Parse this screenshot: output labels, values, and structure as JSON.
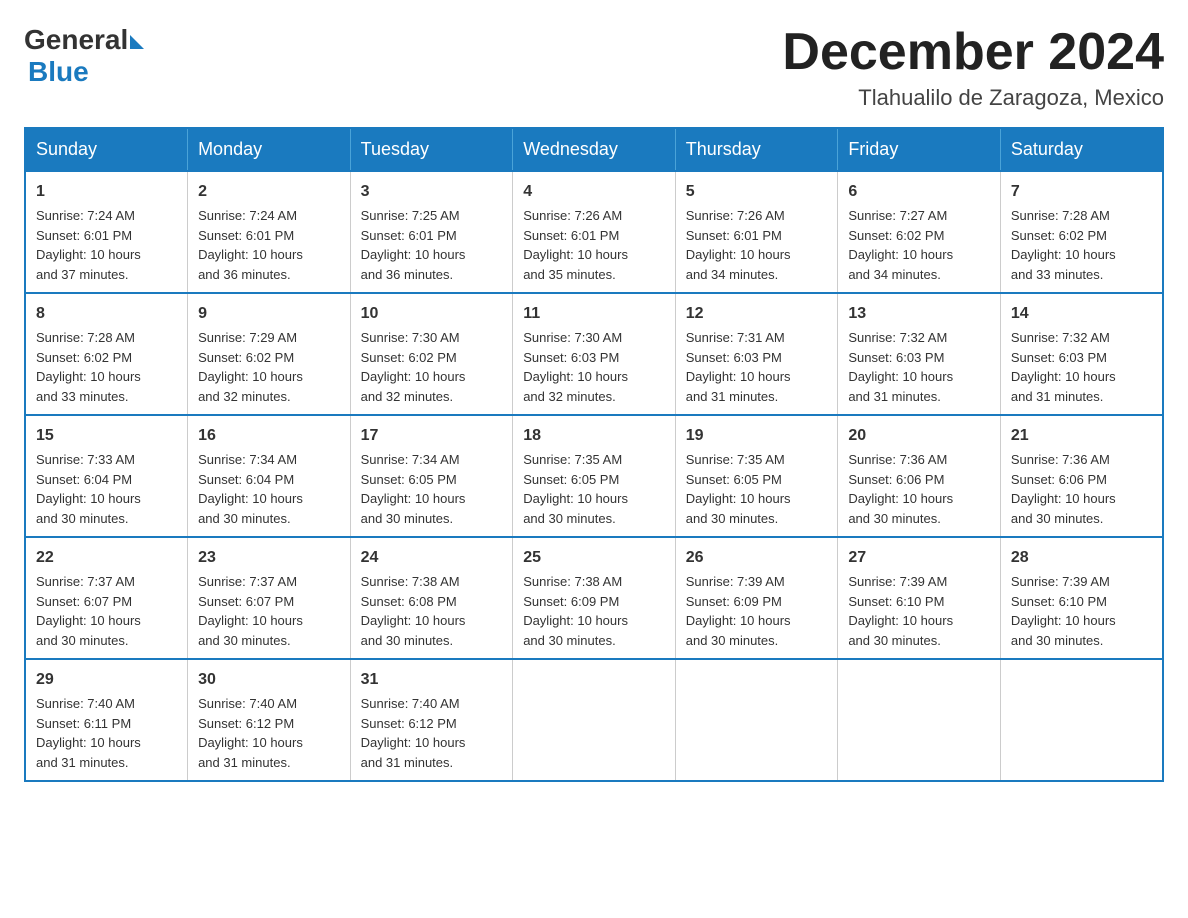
{
  "logo": {
    "general": "General",
    "blue": "Blue"
  },
  "title": "December 2024",
  "subtitle": "Tlahualilo de Zaragoza, Mexico",
  "days_of_week": [
    "Sunday",
    "Monday",
    "Tuesday",
    "Wednesday",
    "Thursday",
    "Friday",
    "Saturday"
  ],
  "weeks": [
    [
      {
        "day": "1",
        "info": "Sunrise: 7:24 AM\nSunset: 6:01 PM\nDaylight: 10 hours\nand 37 minutes."
      },
      {
        "day": "2",
        "info": "Sunrise: 7:24 AM\nSunset: 6:01 PM\nDaylight: 10 hours\nand 36 minutes."
      },
      {
        "day": "3",
        "info": "Sunrise: 7:25 AM\nSunset: 6:01 PM\nDaylight: 10 hours\nand 36 minutes."
      },
      {
        "day": "4",
        "info": "Sunrise: 7:26 AM\nSunset: 6:01 PM\nDaylight: 10 hours\nand 35 minutes."
      },
      {
        "day": "5",
        "info": "Sunrise: 7:26 AM\nSunset: 6:01 PM\nDaylight: 10 hours\nand 34 minutes."
      },
      {
        "day": "6",
        "info": "Sunrise: 7:27 AM\nSunset: 6:02 PM\nDaylight: 10 hours\nand 34 minutes."
      },
      {
        "day": "7",
        "info": "Sunrise: 7:28 AM\nSunset: 6:02 PM\nDaylight: 10 hours\nand 33 minutes."
      }
    ],
    [
      {
        "day": "8",
        "info": "Sunrise: 7:28 AM\nSunset: 6:02 PM\nDaylight: 10 hours\nand 33 minutes."
      },
      {
        "day": "9",
        "info": "Sunrise: 7:29 AM\nSunset: 6:02 PM\nDaylight: 10 hours\nand 32 minutes."
      },
      {
        "day": "10",
        "info": "Sunrise: 7:30 AM\nSunset: 6:02 PM\nDaylight: 10 hours\nand 32 minutes."
      },
      {
        "day": "11",
        "info": "Sunrise: 7:30 AM\nSunset: 6:03 PM\nDaylight: 10 hours\nand 32 minutes."
      },
      {
        "day": "12",
        "info": "Sunrise: 7:31 AM\nSunset: 6:03 PM\nDaylight: 10 hours\nand 31 minutes."
      },
      {
        "day": "13",
        "info": "Sunrise: 7:32 AM\nSunset: 6:03 PM\nDaylight: 10 hours\nand 31 minutes."
      },
      {
        "day": "14",
        "info": "Sunrise: 7:32 AM\nSunset: 6:03 PM\nDaylight: 10 hours\nand 31 minutes."
      }
    ],
    [
      {
        "day": "15",
        "info": "Sunrise: 7:33 AM\nSunset: 6:04 PM\nDaylight: 10 hours\nand 30 minutes."
      },
      {
        "day": "16",
        "info": "Sunrise: 7:34 AM\nSunset: 6:04 PM\nDaylight: 10 hours\nand 30 minutes."
      },
      {
        "day": "17",
        "info": "Sunrise: 7:34 AM\nSunset: 6:05 PM\nDaylight: 10 hours\nand 30 minutes."
      },
      {
        "day": "18",
        "info": "Sunrise: 7:35 AM\nSunset: 6:05 PM\nDaylight: 10 hours\nand 30 minutes."
      },
      {
        "day": "19",
        "info": "Sunrise: 7:35 AM\nSunset: 6:05 PM\nDaylight: 10 hours\nand 30 minutes."
      },
      {
        "day": "20",
        "info": "Sunrise: 7:36 AM\nSunset: 6:06 PM\nDaylight: 10 hours\nand 30 minutes."
      },
      {
        "day": "21",
        "info": "Sunrise: 7:36 AM\nSunset: 6:06 PM\nDaylight: 10 hours\nand 30 minutes."
      }
    ],
    [
      {
        "day": "22",
        "info": "Sunrise: 7:37 AM\nSunset: 6:07 PM\nDaylight: 10 hours\nand 30 minutes."
      },
      {
        "day": "23",
        "info": "Sunrise: 7:37 AM\nSunset: 6:07 PM\nDaylight: 10 hours\nand 30 minutes."
      },
      {
        "day": "24",
        "info": "Sunrise: 7:38 AM\nSunset: 6:08 PM\nDaylight: 10 hours\nand 30 minutes."
      },
      {
        "day": "25",
        "info": "Sunrise: 7:38 AM\nSunset: 6:09 PM\nDaylight: 10 hours\nand 30 minutes."
      },
      {
        "day": "26",
        "info": "Sunrise: 7:39 AM\nSunset: 6:09 PM\nDaylight: 10 hours\nand 30 minutes."
      },
      {
        "day": "27",
        "info": "Sunrise: 7:39 AM\nSunset: 6:10 PM\nDaylight: 10 hours\nand 30 minutes."
      },
      {
        "day": "28",
        "info": "Sunrise: 7:39 AM\nSunset: 6:10 PM\nDaylight: 10 hours\nand 30 minutes."
      }
    ],
    [
      {
        "day": "29",
        "info": "Sunrise: 7:40 AM\nSunset: 6:11 PM\nDaylight: 10 hours\nand 31 minutes."
      },
      {
        "day": "30",
        "info": "Sunrise: 7:40 AM\nSunset: 6:12 PM\nDaylight: 10 hours\nand 31 minutes."
      },
      {
        "day": "31",
        "info": "Sunrise: 7:40 AM\nSunset: 6:12 PM\nDaylight: 10 hours\nand 31 minutes."
      },
      {
        "day": "",
        "info": ""
      },
      {
        "day": "",
        "info": ""
      },
      {
        "day": "",
        "info": ""
      },
      {
        "day": "",
        "info": ""
      }
    ]
  ]
}
